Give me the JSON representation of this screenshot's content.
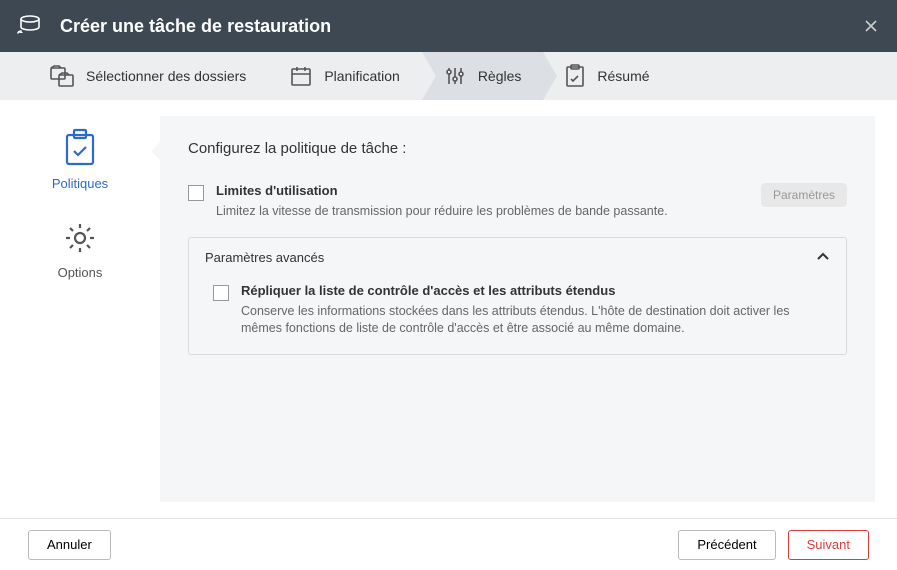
{
  "header": {
    "title": "Créer une tâche de restauration"
  },
  "steps": [
    {
      "label": "Sélectionner des dossiers"
    },
    {
      "label": "Planification"
    },
    {
      "label": "Règles"
    },
    {
      "label": "Résumé"
    }
  ],
  "sidebar": {
    "items": [
      {
        "label": "Politiques"
      },
      {
        "label": "Options"
      }
    ]
  },
  "main": {
    "title": "Configurez la politique de tâche :",
    "usage_limits": {
      "label": "Limites d'utilisation",
      "desc": "Limitez la vitesse de transmission pour réduire les problèmes de bande passante.",
      "settings_btn": "Paramètres"
    },
    "advanced": {
      "title": "Paramètres avancés",
      "acl": {
        "label": "Répliquer la liste de contrôle d'accès et les attributs étendus",
        "desc": "Conserve les informations stockées dans les attributs étendus. L'hôte de destination doit activer les mêmes fonctions de liste de contrôle d'accès et être associé au même domaine."
      }
    }
  },
  "footer": {
    "cancel": "Annuler",
    "prev": "Précédent",
    "next": "Suivant"
  }
}
